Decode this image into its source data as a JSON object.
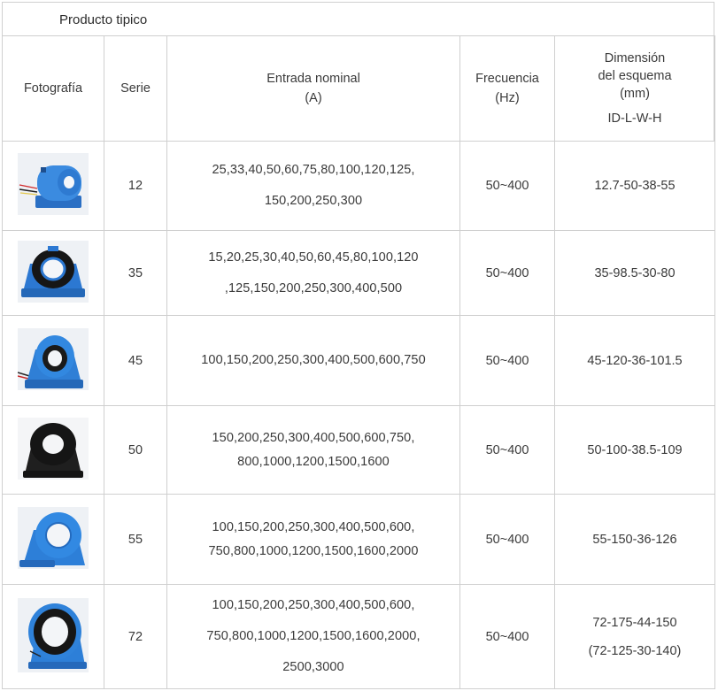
{
  "title": "Producto tipico",
  "headers": {
    "photo": "Fotografía",
    "series": "Serie",
    "current_line1": "Entrada nominal",
    "current_line2": "(A)",
    "frequency_line1": "Frecuencia",
    "frequency_line2": "(Hz)",
    "dimension_line1": "Dimensión",
    "dimension_line2": "del esquema",
    "dimension_line3": "(mm)",
    "dimension_format": "ID-L-W-H"
  },
  "rows": [
    {
      "series": "12",
      "current_line1": "25,33,40,50,60,75,80,100,120,125,",
      "current_line2": "150,200,250,300",
      "frequency": "50~400",
      "dimension_line1": "12.7-50-38-55",
      "dimension_line2": "",
      "photo_icon": "blue-current-transformer-with-leads-icon"
    },
    {
      "series": "35",
      "current_line1": "15,20,25,30,40,50,60,45,80,100,120",
      "current_line2": ",125,150,200,250,300,400,500",
      "frequency": "50~400",
      "dimension_line1": "35-98.5-30-80",
      "dimension_line2": "",
      "photo_icon": "blue-black-ring-transformer-icon"
    },
    {
      "series": "45",
      "current_line1": "100,150,200,250,300,400,500,600,750",
      "current_line2": "",
      "frequency": "50~400",
      "dimension_line1": "45-120-36-101.5",
      "dimension_line2": "",
      "photo_icon": "blue-ring-transformer-with-leads-icon"
    },
    {
      "series": "50",
      "current_line1": "150,200,250,300,400,500,600,750,",
      "current_line2": "800,1000,1200,1500,1600",
      "frequency": "50~400",
      "dimension_line1": "50-100-38.5-109",
      "dimension_line2": "",
      "photo_icon": "black-ring-transformer-icon"
    },
    {
      "series": "55",
      "current_line1": "100,150,200,250,300,400,500,600,",
      "current_line2": "750,800,1000,1200,1500,1600,2000",
      "frequency": "50~400",
      "dimension_line1": "55-150-36-126",
      "dimension_line2": "",
      "photo_icon": "blue-ring-transformer-icon"
    },
    {
      "series": "72",
      "current_line1": "100,150,200,250,300,400,500,600,",
      "current_line2": "750,800,1000,1200,1500,1600,2000,",
      "current_line3": "2500,3000",
      "frequency": "50~400",
      "dimension_line1": "72-175-44-150",
      "dimension_line2": "(72-125-30-140)",
      "photo_icon": "large-blue-black-ring-transformer-icon"
    }
  ],
  "colors": {
    "border": "#cfcfcf",
    "text": "#3a3a3a",
    "product_blue": "#2f7fd6",
    "product_black": "#1c1c1c"
  }
}
